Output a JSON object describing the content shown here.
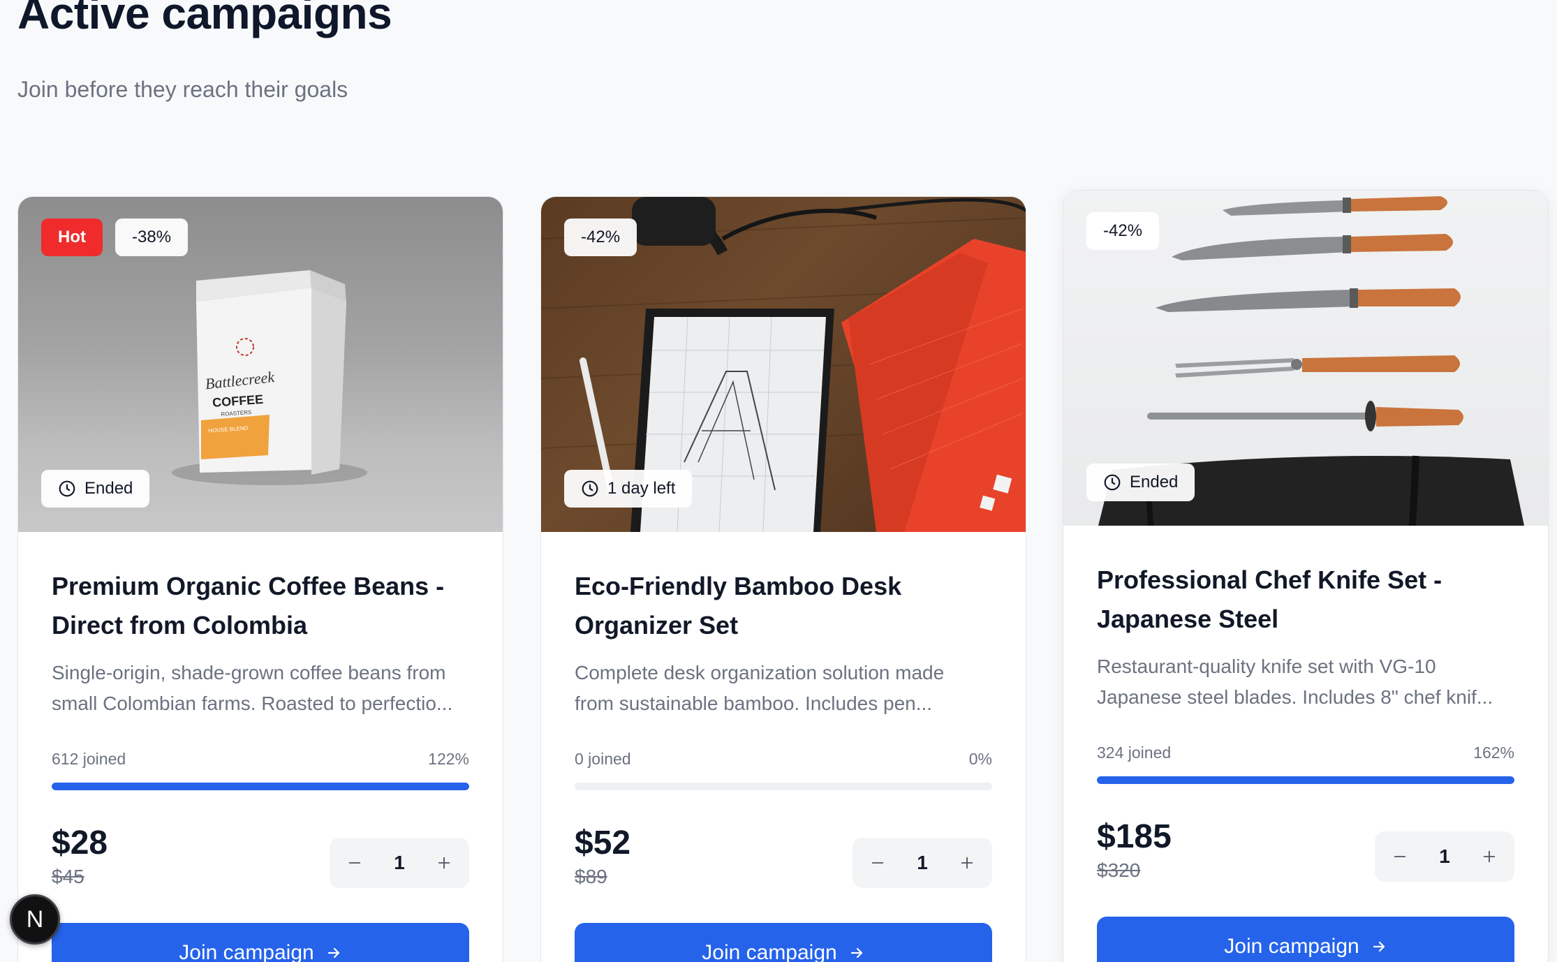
{
  "header": {
    "title": "Active campaigns",
    "subtitle": "Join before they reach their goals"
  },
  "campaigns": [
    {
      "tags": [
        "Hot",
        "-38%"
      ],
      "time_status": "Ended",
      "title_line1": "Premium Organic Coffee Beans -",
      "title_line2": "Direct from Colombia",
      "desc_line1": "Single-origin, shade-grown coffee beans from",
      "desc_line2": "small Colombian farms. Roasted to perfectio...",
      "joined": "612 joined",
      "percent": "122%",
      "progress": 1.0,
      "price": "$28",
      "original_price": "$45",
      "quantity": "1",
      "cta": "Join campaign",
      "package_text": [
        "Battlecreek",
        "COFFEE",
        "ROASTERS",
        "HOUSE BLEND"
      ]
    },
    {
      "tags": [
        "-42%"
      ],
      "time_status": "1 day left",
      "title_line1": "Eco-Friendly Bamboo Desk",
      "title_line2": "Organizer Set",
      "desc_line1": "Complete desk organization solution made",
      "desc_line2": "from sustainable bamboo. Includes pen...",
      "joined": "0 joined",
      "percent": "0%",
      "progress": 0.0,
      "price": "$52",
      "original_price": "$89",
      "quantity": "1",
      "cta": "Join campaign"
    },
    {
      "tags": [
        "-42%"
      ],
      "time_status": "Ended",
      "title_line1": "Professional Chef Knife Set -",
      "title_line2": "Japanese Steel",
      "desc_line1": "Restaurant-quality knife set with VG-10",
      "desc_line2": "Japanese steel blades. Includes 8\" chef knif...",
      "joined": "324 joined",
      "percent": "162%",
      "progress": 1.0,
      "price": "$185",
      "original_price": "$320",
      "quantity": "1",
      "cta": "Join campaign"
    }
  ],
  "dev_indicator": {
    "label": "N"
  },
  "colors": {
    "primary": "#2563eb",
    "hot": "#ef2b2b",
    "muted_text": "#6b7280",
    "background": "#f8f9fb"
  },
  "icons": [
    "clock-icon",
    "minus-icon",
    "plus-icon",
    "arrow-right-icon"
  ]
}
